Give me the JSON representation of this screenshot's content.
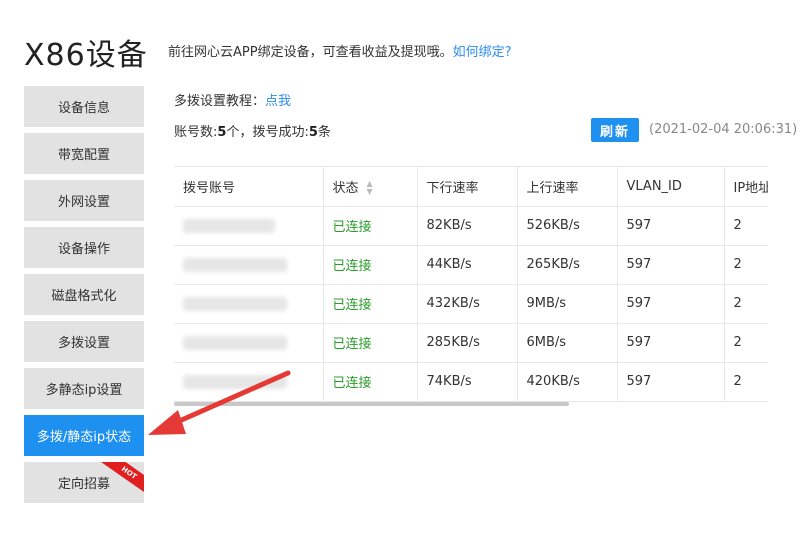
{
  "page": {
    "title": "X86设备",
    "intro_text": "前往网心云APP绑定设备，可查看收益及提现哦。",
    "intro_link": "如何绑定?"
  },
  "sidebar": {
    "items": [
      {
        "label": "设备信息"
      },
      {
        "label": "带宽配置"
      },
      {
        "label": "外网设置"
      },
      {
        "label": "设备操作"
      },
      {
        "label": "磁盘格式化"
      },
      {
        "label": "多拨设置"
      },
      {
        "label": "多静态ip设置"
      },
      {
        "label": "多拨/静态ip状态",
        "active": true
      },
      {
        "label": "定向招募",
        "badge": "HOT"
      }
    ]
  },
  "main": {
    "tutorial_label": "多拨设置教程：",
    "tutorial_link": "点我",
    "summary_prefix": "账号数:",
    "account_count": "5",
    "summary_middle": "个，拨号成功:",
    "success_count": "5",
    "summary_suffix": "条",
    "refresh_label": "刷新",
    "timestamp": "(2021-02-04 20:06:31)"
  },
  "table": {
    "columns": [
      "拨号账号",
      "状态",
      "下行速率",
      "上行速率",
      "VLAN_ID",
      "IP地址"
    ],
    "rows": [
      {
        "account": "",
        "status": "已连接",
        "down": "82KB/s",
        "up": "526KB/s",
        "vlan": "597",
        "ip": "2"
      },
      {
        "account": "",
        "status": "已连接",
        "down": "44KB/s",
        "up": "265KB/s",
        "vlan": "597",
        "ip": "2"
      },
      {
        "account": "",
        "status": "已连接",
        "down": "432KB/s",
        "up": "9MB/s",
        "vlan": "597",
        "ip": "2"
      },
      {
        "account": "",
        "status": "已连接",
        "down": "285KB/s",
        "up": "6MB/s",
        "vlan": "597",
        "ip": "2"
      },
      {
        "account": "",
        "status": "已连接",
        "down": "74KB/s",
        "up": "420KB/s",
        "vlan": "597",
        "ip": "2"
      }
    ]
  },
  "colors": {
    "accent": "#1e90f0",
    "link": "#2d8cf0",
    "status_ok": "#2a9d2a",
    "annotation_arrow": "#e53935",
    "hot_badge": "#e02020"
  },
  "icons": {
    "sort": "sort-icon",
    "annotation": "arrow-icon"
  }
}
